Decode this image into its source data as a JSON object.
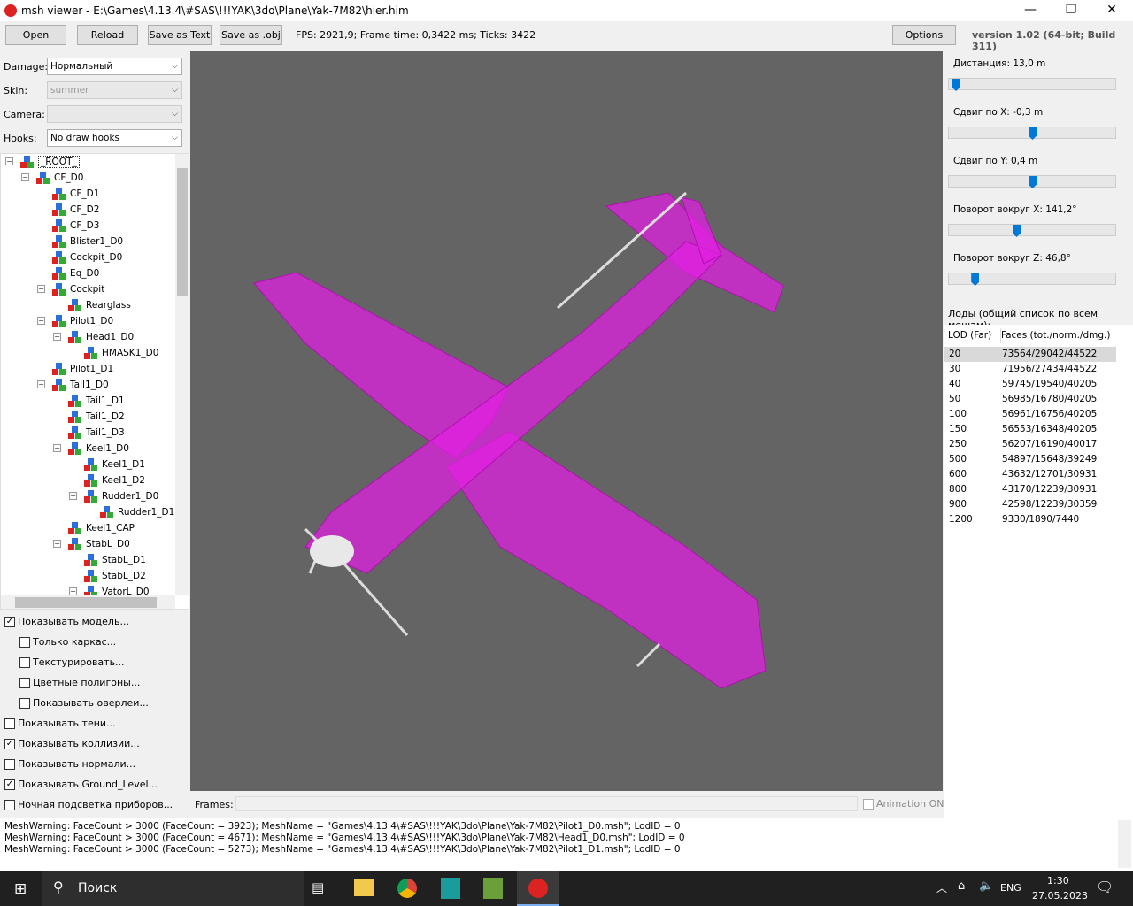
{
  "window": {
    "title": "msh viewer - E:\\Games\\4.13.4\\#SAS\\!!!YAK\\3do\\Plane\\Yak-7M82\\hier.him",
    "minimize": "—",
    "maximize": "❐",
    "close": "✕"
  },
  "toolbar": {
    "open": "Open",
    "reload": "Reload",
    "save_text": "Save as Text",
    "save_obj": "Save as .obj",
    "stats": "FPS: 2921,9; Frame time: 0,3422 ms; Ticks: 3422",
    "options": "Options",
    "version": "version 1.02 (64-bit; Build 311)"
  },
  "left": {
    "damage_label": "Damage:",
    "damage_value": "Нормальный",
    "skin_label": "Skin:",
    "skin_value": "summer",
    "camera_label": "Camera:",
    "camera_value": "",
    "hooks_label": "Hooks:",
    "hooks_value": "No draw hooks"
  },
  "tree": [
    {
      "label": "_ROOT_",
      "level": 0,
      "exp": true
    },
    {
      "label": "CF_D0",
      "level": 1,
      "exp": true
    },
    {
      "label": "CF_D1",
      "level": 2
    },
    {
      "label": "CF_D2",
      "level": 2
    },
    {
      "label": "CF_D3",
      "level": 2
    },
    {
      "label": "Blister1_D0",
      "level": 2
    },
    {
      "label": "Cockpit_D0",
      "level": 2
    },
    {
      "label": "Eq_D0",
      "level": 2
    },
    {
      "label": "Cockpit",
      "level": 2,
      "exp": true
    },
    {
      "label": "Rearglass",
      "level": 3
    },
    {
      "label": "Pilot1_D0",
      "level": 2,
      "exp": true
    },
    {
      "label": "Head1_D0",
      "level": 3,
      "exp": true
    },
    {
      "label": "HMASK1_D0",
      "level": 4
    },
    {
      "label": "Pilot1_D1",
      "level": 2
    },
    {
      "label": "Tail1_D0",
      "level": 2,
      "exp": true
    },
    {
      "label": "Tail1_D1",
      "level": 3
    },
    {
      "label": "Tail1_D2",
      "level": 3
    },
    {
      "label": "Tail1_D3",
      "level": 3
    },
    {
      "label": "Keel1_D0",
      "level": 3,
      "exp": true
    },
    {
      "label": "Keel1_D1",
      "level": 4
    },
    {
      "label": "Keel1_D2",
      "level": 4
    },
    {
      "label": "Rudder1_D0",
      "level": 4,
      "exp": true
    },
    {
      "label": "Rudder1_D1",
      "level": 5
    },
    {
      "label": "Keel1_CAP",
      "level": 3
    },
    {
      "label": "StabL_D0",
      "level": 3,
      "exp": true
    },
    {
      "label": "StabL_D1",
      "level": 4
    },
    {
      "label": "StabL_D2",
      "level": 4
    },
    {
      "label": "VatorL_D0",
      "level": 4,
      "exp": true
    }
  ],
  "checks": [
    {
      "label": "Показывать модель...",
      "checked": true,
      "indent": 0
    },
    {
      "label": "Только каркас...",
      "checked": false,
      "indent": 1
    },
    {
      "label": "Текстурировать...",
      "checked": false,
      "indent": 1
    },
    {
      "label": "Цветные полигоны...",
      "checked": false,
      "indent": 1
    },
    {
      "label": "Показывать оверлеи...",
      "checked": false,
      "indent": 1
    },
    {
      "label": "Показывать тени...",
      "checked": false,
      "indent": 0
    },
    {
      "label": "Показывать коллизии...",
      "checked": true,
      "indent": 0
    },
    {
      "label": "Показывать нормали...",
      "checked": false,
      "indent": 0
    },
    {
      "label": "Показывать Ground_Level...",
      "checked": true,
      "indent": 0
    },
    {
      "label": "Ночная подсветка приборов...",
      "checked": false,
      "indent": 0
    }
  ],
  "frames": {
    "label": "Frames:",
    "animation": "Animation ON"
  },
  "sliders": [
    {
      "label": "Дистанция:  13,0 m",
      "value": 0.02
    },
    {
      "label": "Сдвиг по X:  -0,3 m",
      "value": 0.5
    },
    {
      "label": "Сдвиг по Y:  0,4 m",
      "value": 0.5
    },
    {
      "label": "Поворот вокруг X:  141,2°",
      "value": 0.4
    },
    {
      "label": "Поворот вокруг Z:  46,8°",
      "value": 0.14
    }
  ],
  "lods": {
    "title": "Лоды (общий список по всем мешам):",
    "col_lod": "LOD (Far)",
    "col_faces": "Faces (tot./norm./dmg.)",
    "rows": [
      [
        "20",
        "73564/29042/44522"
      ],
      [
        "30",
        "71956/27434/44522"
      ],
      [
        "40",
        "59745/19540/40205"
      ],
      [
        "50",
        "56985/16780/40205"
      ],
      [
        "100",
        "56961/16756/40205"
      ],
      [
        "150",
        "56553/16348/40205"
      ],
      [
        "250",
        "56207/16190/40017"
      ],
      [
        "500",
        "54897/15648/39249"
      ],
      [
        "600",
        "43632/12701/30931"
      ],
      [
        "800",
        "43170/12239/30931"
      ],
      [
        "900",
        "42598/12239/30359"
      ],
      [
        "1200",
        "9330/1890/7440"
      ]
    ]
  },
  "log": [
    "MeshWarning: FaceCount > 3000 (FaceCount = 3923); MeshName = \"Games\\4.13.4\\#SAS\\!!!YAK\\3do\\Plane\\Yak-7M82\\Pilot1_D0.msh\"; LodID = 0",
    "MeshWarning: FaceCount > 3000 (FaceCount = 4671); MeshName = \"Games\\4.13.4\\#SAS\\!!!YAK\\3do\\Plane\\Yak-7M82\\Head1_D0.msh\"; LodID = 0",
    "MeshWarning: FaceCount > 3000 (FaceCount = 5273); MeshName = \"Games\\4.13.4\\#SAS\\!!!YAK\\3do\\Plane\\Yak-7M82\\Pilot1_D1.msh\"; LodID = 0"
  ],
  "taskbar": {
    "search": "Поиск",
    "lang": "ENG",
    "time": "1:30",
    "date": "27.05.2023"
  }
}
